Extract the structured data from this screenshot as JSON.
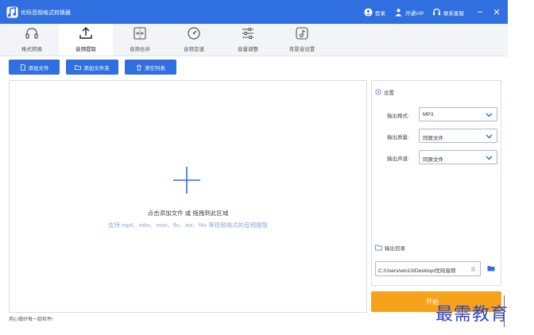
{
  "window": {
    "title": "优码音频格式转换器",
    "actions": {
      "login": "登录",
      "vip": "开通VIP",
      "support": "联系客服"
    }
  },
  "toolbar": {
    "tabs": [
      {
        "label": "格式转换",
        "icon": "headphones-icon"
      },
      {
        "label": "音频提取",
        "icon": "upload-icon",
        "active": true
      },
      {
        "label": "音频合并",
        "icon": "merge-icon"
      },
      {
        "label": "音频变速",
        "icon": "speed-dial-icon"
      },
      {
        "label": "音量调整",
        "icon": "sliders-icon"
      },
      {
        "label": "背景音设置",
        "icon": "music-note-icon"
      }
    ]
  },
  "actions": {
    "add_file": "添加文件",
    "add_folder": "添加文件夹",
    "clear_list": "清空列表"
  },
  "dropzone": {
    "hint": "点击添加文件 或 拖拽到此区域",
    "support": "支持 mp4、mkv、mov、flv、avi、f4v 等视频格式的音频提取"
  },
  "settings": {
    "header": "设置",
    "rows": [
      {
        "label": "输出格式:",
        "value": "MP3"
      },
      {
        "label": "输出质量:",
        "value": "同原文件"
      },
      {
        "label": "输出声道:",
        "value": "同原文件"
      }
    ],
    "output_header": "输出目录",
    "output_path": "C:/Users/win10/Desktop/优码音频"
  },
  "start_button": "开始",
  "watermark": "最需教育",
  "status": "用心做好每一款软件!",
  "colors": {
    "primary": "#2f6fe0",
    "accent": "#f7a21b",
    "watermark": "#2a45c9"
  }
}
